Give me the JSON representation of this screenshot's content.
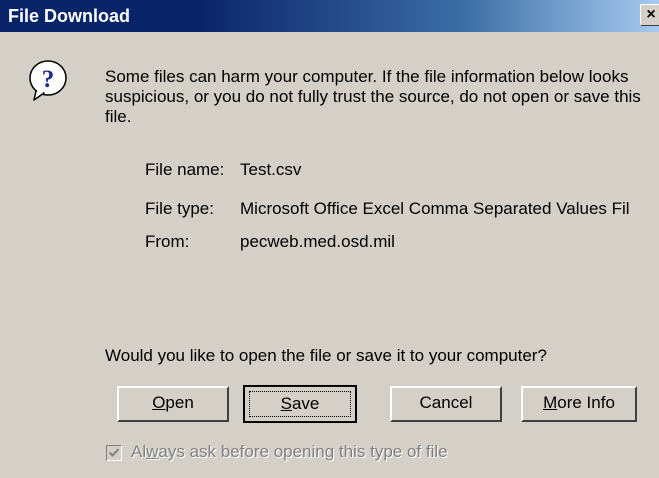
{
  "window": {
    "title": "File Download",
    "close_glyph": "×"
  },
  "icons": {
    "question": "question-icon",
    "close": "close-icon",
    "check": "check-icon"
  },
  "message": "Some files can harm your computer. If the file information below looks suspicious, or you do not fully trust the source, do not open or save this file.",
  "file_info": {
    "name_label": "File name:",
    "name_value": "Test.csv",
    "type_label": "File type:",
    "type_value": "Microsoft Office Excel Comma Separated Values Fil",
    "from_label": "From:",
    "from_value": "pecweb.med.osd.mil"
  },
  "question": "Would you like to open the file or save it to your computer?",
  "buttons": {
    "open": {
      "mnemonic": "O",
      "rest": "pen"
    },
    "save": {
      "mnemonic": "S",
      "rest": "ave"
    },
    "cancel": "Cancel",
    "more_info": {
      "mnemonic": "M",
      "rest": "ore Info"
    }
  },
  "checkbox": {
    "label_pre": "Al",
    "label_mnemonic": "w",
    "label_post": "ays ask before opening this type of file",
    "checked": true,
    "enabled": false
  },
  "colors": {
    "face": "#d4d0c8",
    "title_start": "#0a246a",
    "title_end": "#a6caf0",
    "icon_blue": "#1b2a8f",
    "disabled_text": "#808080"
  }
}
